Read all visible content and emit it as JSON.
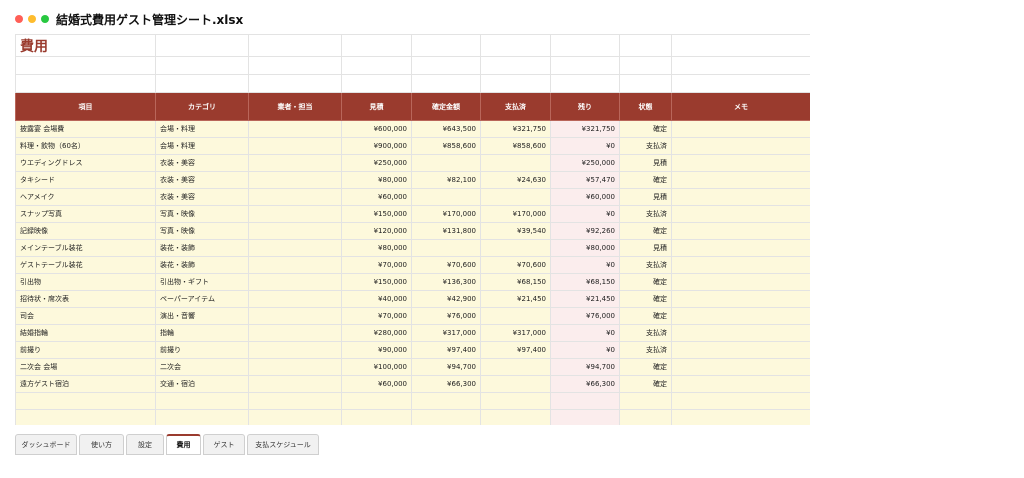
{
  "window": {
    "title": "結婚式費用ゲスト管理シート.xlsx",
    "controls": {
      "close_color": "#ff5f57",
      "minimize_color": "#febc2e",
      "maximize_color": "#28c840"
    }
  },
  "sheet": {
    "title": "費用",
    "colors": {
      "header_bg": "#9a3b2e",
      "row_bg": "#fdf9dc",
      "remaining_bg": "#fbeded"
    },
    "columns": [
      "項目",
      "カテゴリ",
      "業者・担当",
      "見積",
      "確定金額",
      "支払済",
      "残り",
      "状態",
      "メモ"
    ],
    "rows": [
      [
        "披露宴 会場費",
        "会場・料理",
        "",
        "¥600,000",
        "¥643,500",
        "¥321,750",
        "¥321,750",
        "確定",
        ""
      ],
      [
        "料理・飲物（60名）",
        "会場・料理",
        "",
        "¥900,000",
        "¥858,600",
        "¥858,600",
        "¥0",
        "支払済",
        ""
      ],
      [
        "ウエディングドレス",
        "衣装・美容",
        "",
        "¥250,000",
        "",
        "",
        "¥250,000",
        "見積",
        ""
      ],
      [
        "タキシード",
        "衣装・美容",
        "",
        "¥80,000",
        "¥82,100",
        "¥24,630",
        "¥57,470",
        "確定",
        ""
      ],
      [
        "ヘアメイク",
        "衣装・美容",
        "",
        "¥60,000",
        "",
        "",
        "¥60,000",
        "見積",
        ""
      ],
      [
        "スナップ写真",
        "写真・映像",
        "",
        "¥150,000",
        "¥170,000",
        "¥170,000",
        "¥0",
        "支払済",
        ""
      ],
      [
        "記録映像",
        "写真・映像",
        "",
        "¥120,000",
        "¥131,800",
        "¥39,540",
        "¥92,260",
        "確定",
        ""
      ],
      [
        "メインテーブル装花",
        "装花・装飾",
        "",
        "¥80,000",
        "",
        "",
        "¥80,000",
        "見積",
        ""
      ],
      [
        "ゲストテーブル装花",
        "装花・装飾",
        "",
        "¥70,000",
        "¥70,600",
        "¥70,600",
        "¥0",
        "支払済",
        ""
      ],
      [
        "引出物",
        "引出物・ギフト",
        "",
        "¥150,000",
        "¥136,300",
        "¥68,150",
        "¥68,150",
        "確定",
        ""
      ],
      [
        "招待状・席次表",
        "ペーパーアイテム",
        "",
        "¥40,000",
        "¥42,900",
        "¥21,450",
        "¥21,450",
        "確定",
        ""
      ],
      [
        "司会",
        "演出・音響",
        "",
        "¥70,000",
        "¥76,000",
        "",
        "¥76,000",
        "確定",
        ""
      ],
      [
        "結婚指輪",
        "指輪",
        "",
        "¥280,000",
        "¥317,000",
        "¥317,000",
        "¥0",
        "支払済",
        ""
      ],
      [
        "前撮り",
        "前撮り",
        "",
        "¥90,000",
        "¥97,400",
        "¥97,400",
        "¥0",
        "支払済",
        ""
      ],
      [
        "二次会 会場",
        "二次会",
        "",
        "¥100,000",
        "¥94,700",
        "",
        "¥94,700",
        "確定",
        ""
      ],
      [
        "遠方ゲスト宿泊",
        "交通・宿泊",
        "",
        "¥60,000",
        "¥66,300",
        "",
        "¥66,300",
        "確定",
        ""
      ]
    ]
  },
  "tabs": [
    {
      "label": "ダッシュボード",
      "active": false
    },
    {
      "label": "使い方",
      "active": false
    },
    {
      "label": "設定",
      "active": false
    },
    {
      "label": "費用",
      "active": true
    },
    {
      "label": "ゲスト",
      "active": false
    },
    {
      "label": "支払スケジュール",
      "active": false
    }
  ]
}
